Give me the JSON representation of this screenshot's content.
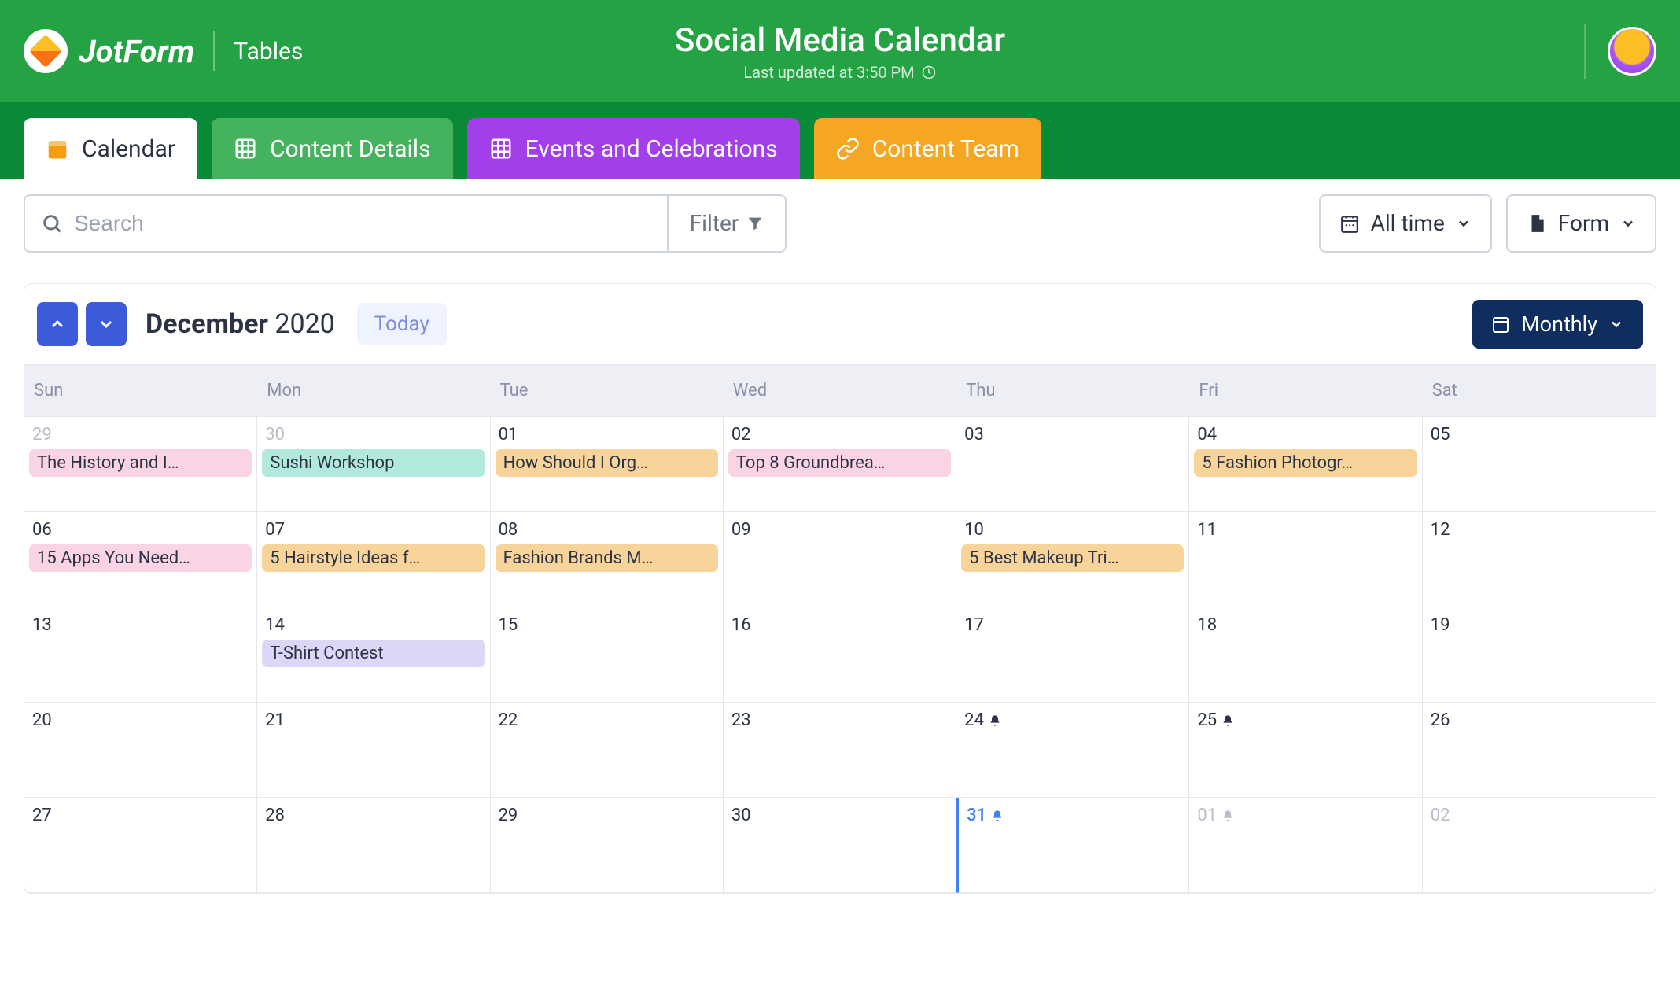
{
  "header": {
    "logo_text": "JotForm",
    "tables_label": "Tables",
    "title": "Social Media Calendar",
    "subtitle": "Last updated at 3:50 PM"
  },
  "tabs": {
    "calendar": "Calendar",
    "content_details": "Content Details",
    "events": "Events and Celebrations",
    "team": "Content Team"
  },
  "toolbar": {
    "search_placeholder": "Search",
    "filter": "Filter",
    "alltime": "All time",
    "form": "Form"
  },
  "calendar": {
    "month": "December",
    "year": "2020",
    "today": "Today",
    "view": "Monthly",
    "dow": [
      "Sun",
      "Mon",
      "Tue",
      "Wed",
      "Thu",
      "Fri",
      "Sat"
    ]
  },
  "days": [
    {
      "n": "29",
      "dim": true,
      "events": [
        {
          "label": "The History and I…",
          "c": "pink"
        }
      ]
    },
    {
      "n": "30",
      "dim": true,
      "events": [
        {
          "label": "Sushi Workshop",
          "c": "teal"
        }
      ]
    },
    {
      "n": "01",
      "events": [
        {
          "label": "How Should I Org…",
          "c": "orange-p"
        }
      ]
    },
    {
      "n": "02",
      "events": [
        {
          "label": "Top 8 Groundbrea…",
          "c": "pink"
        }
      ]
    },
    {
      "n": "03"
    },
    {
      "n": "04",
      "events": [
        {
          "label": "5 Fashion Photogr…",
          "c": "orange-p"
        }
      ]
    },
    {
      "n": "05"
    },
    {
      "n": "06",
      "events": [
        {
          "label": "15 Apps You Need…",
          "c": "pink"
        }
      ]
    },
    {
      "n": "07",
      "events": [
        {
          "label": "5 Hairstyle Ideas f…",
          "c": "orange-p"
        }
      ]
    },
    {
      "n": "08",
      "events": [
        {
          "label": "Fashion Brands M…",
          "c": "orange-p"
        }
      ]
    },
    {
      "n": "09"
    },
    {
      "n": "10",
      "events": [
        {
          "label": "5 Best Makeup Tri…",
          "c": "orange-p"
        }
      ]
    },
    {
      "n": "11"
    },
    {
      "n": "12"
    },
    {
      "n": "13"
    },
    {
      "n": "14",
      "events": [
        {
          "label": "T-Shirt Contest",
          "c": "lav"
        }
      ]
    },
    {
      "n": "15"
    },
    {
      "n": "16"
    },
    {
      "n": "17"
    },
    {
      "n": "18"
    },
    {
      "n": "19"
    },
    {
      "n": "20"
    },
    {
      "n": "21"
    },
    {
      "n": "22"
    },
    {
      "n": "23"
    },
    {
      "n": "24",
      "bell": true
    },
    {
      "n": "25",
      "bell": true
    },
    {
      "n": "26"
    },
    {
      "n": "27"
    },
    {
      "n": "28"
    },
    {
      "n": "29"
    },
    {
      "n": "30"
    },
    {
      "n": "31",
      "bell": true,
      "blue": true,
      "today": true
    },
    {
      "n": "01",
      "dim": true,
      "bell": true,
      "bell_dim": true
    },
    {
      "n": "02",
      "dim": true
    }
  ]
}
